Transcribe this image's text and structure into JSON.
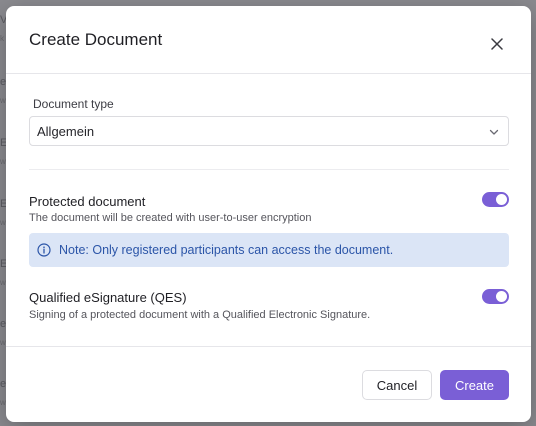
{
  "dialog": {
    "title": "Create Document",
    "close_icon": "close-icon"
  },
  "document_type": {
    "label": "Document type",
    "value": "Allgemein",
    "chevron_icon": "chevron-down-icon"
  },
  "protected": {
    "title": "Protected document",
    "description": "The document will be created with user-to-user encryption",
    "enabled": true
  },
  "note": {
    "icon": "info-icon",
    "text": "Note: Only registered participants can access the document."
  },
  "qes": {
    "title": "Qualified eSignature (QES)",
    "description": "Signing of a protected document with a Qualified Electronic Signature.",
    "enabled": true
  },
  "footer": {
    "cancel_label": "Cancel",
    "create_label": "Create"
  },
  "colors": {
    "accent": "#7a5fd6",
    "note_bg": "#dbe5f6",
    "note_text": "#2b55a8"
  }
}
